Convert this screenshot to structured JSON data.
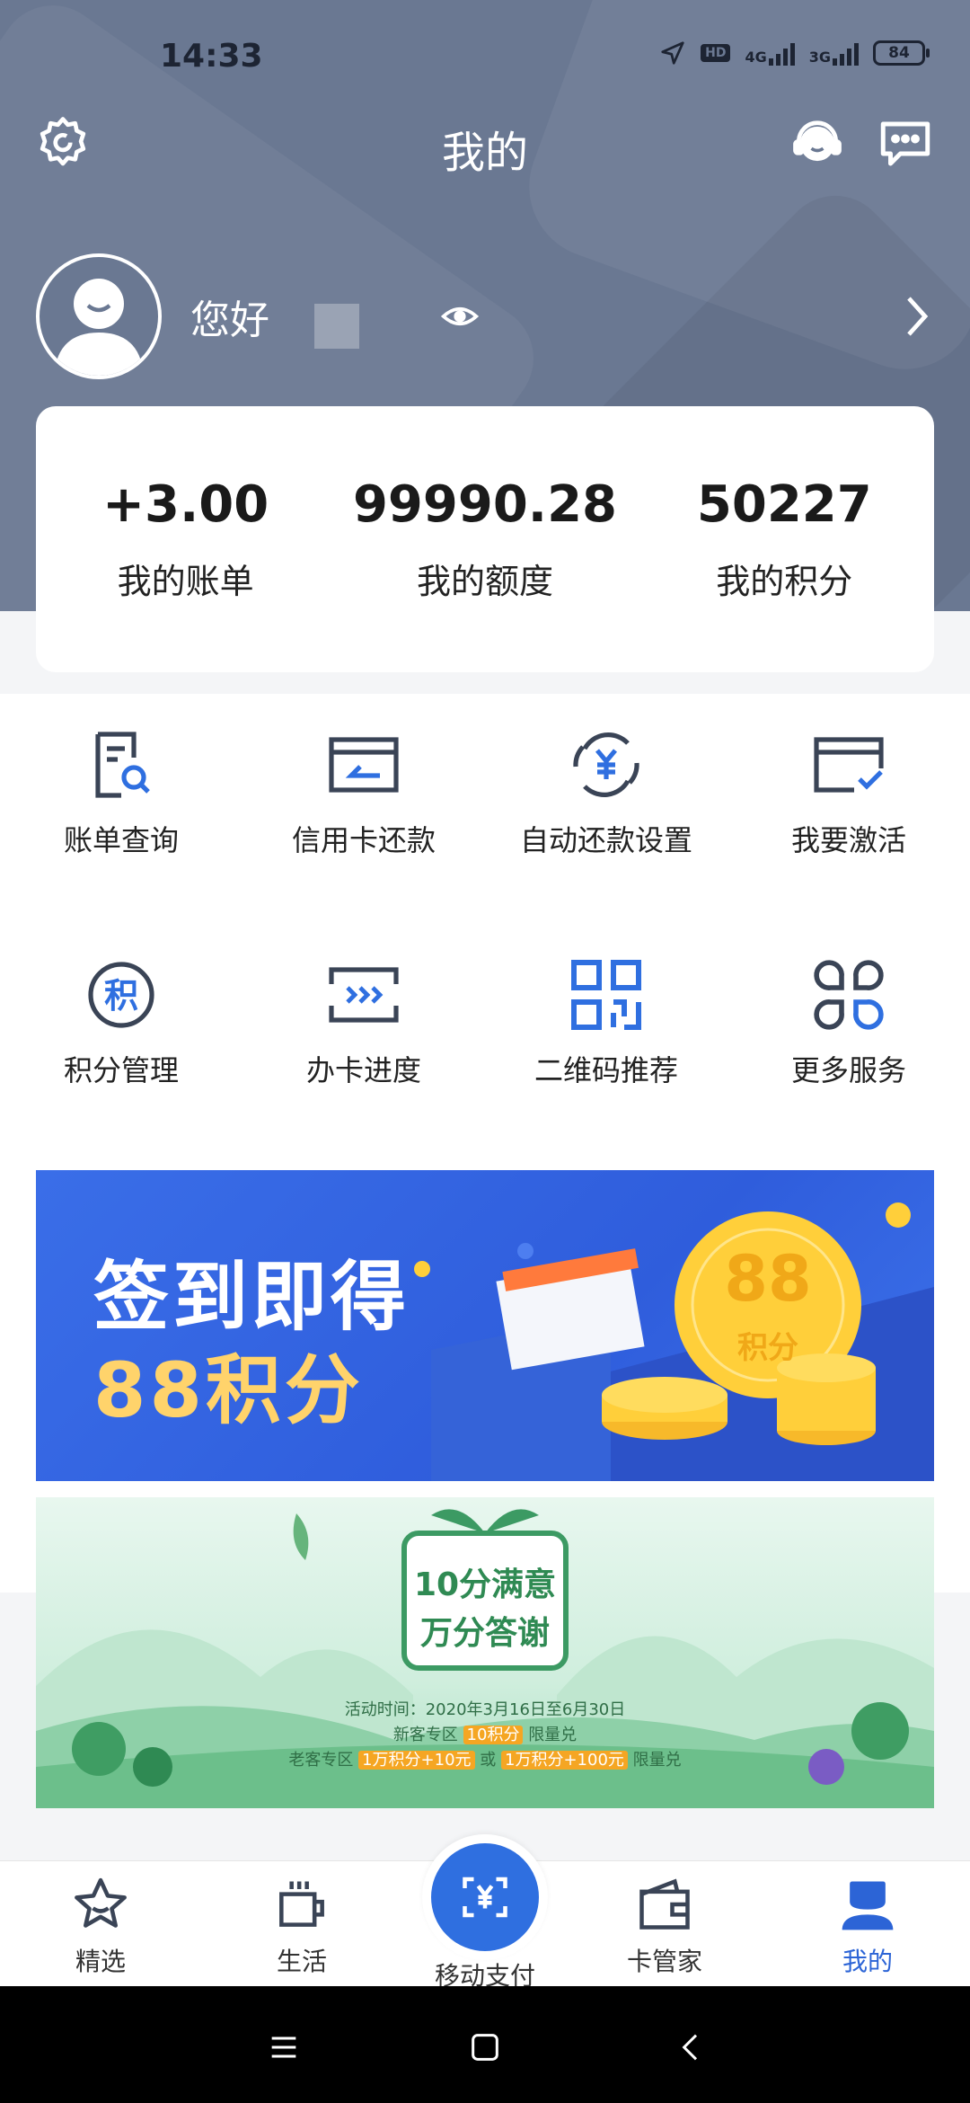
{
  "status_bar": {
    "time": "14:33",
    "net1": "4G",
    "net2": "3G",
    "hd": "HD",
    "battery": "84"
  },
  "header": {
    "title": "我的"
  },
  "profile": {
    "greeting": "您好"
  },
  "summary": [
    {
      "value": "+3.00",
      "label": "我的账单"
    },
    {
      "value": "99990.28",
      "label": "我的额度"
    },
    {
      "value": "50227",
      "label": "我的积分"
    }
  ],
  "services": [
    {
      "label": "账单查询",
      "icon": "bill-search-icon"
    },
    {
      "label": "信用卡还款",
      "icon": "card-repay-icon"
    },
    {
      "label": "自动还款设置",
      "icon": "auto-repay-icon"
    },
    {
      "label": "我要激活",
      "icon": "activate-card-icon"
    },
    {
      "label": "积分管理",
      "icon": "points-manage-icon"
    },
    {
      "label": "办卡进度",
      "icon": "card-progress-icon"
    },
    {
      "label": "二维码推荐",
      "icon": "qr-code-icon"
    },
    {
      "label": "更多服务",
      "icon": "more-services-icon"
    }
  ],
  "banner1": {
    "line1": "签到即得",
    "line2": "88积分",
    "coin_number": "88",
    "coin_label": "积分"
  },
  "banner2": {
    "logo_line1": "10分满意",
    "logo_line2": "万分答谢",
    "activity_time": "活动时间：2020年3月16日至6月30日",
    "new_customer": {
      "prefix": "新客专区",
      "highlight": "10积分",
      "suffix": "限量兑"
    },
    "old_customer": {
      "prefix": "老客专区",
      "highlight1": "1万积分+10元",
      "middle": "或",
      "highlight2": "1万积分+100元",
      "suffix": "限量兑"
    }
  },
  "tabbar": {
    "tabs": [
      {
        "label": "精选",
        "icon": "star-icon"
      },
      {
        "label": "生活",
        "icon": "cup-icon"
      },
      {
        "label": "移动支付",
        "icon": "scan-pay-icon"
      },
      {
        "label": "卡管家",
        "icon": "wallet-icon"
      },
      {
        "label": "我的",
        "icon": "user-icon"
      }
    ],
    "active_color": "#2c64d6"
  },
  "colors": {
    "header_bg": "#6a7892",
    "accent": "#2f6fe0",
    "icon_dark": "#3a4456"
  }
}
